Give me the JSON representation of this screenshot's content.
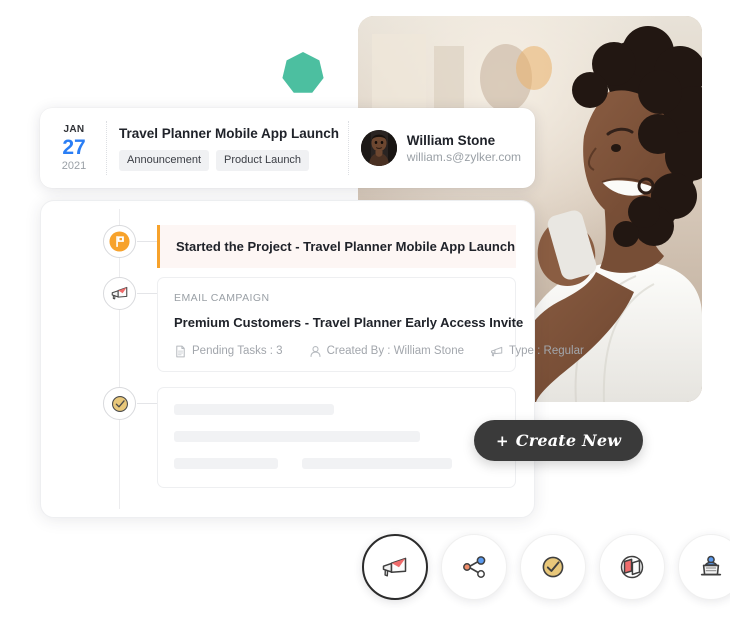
{
  "decor": {
    "heptagon_color": "#4cbfa0"
  },
  "photo": {
    "alt": "woman-on-phone-photo",
    "bg_color": "#c8b6a4"
  },
  "meta_card": {
    "date": {
      "month": "JAN",
      "day": "27",
      "year": "2021",
      "day_color": "#2a7ef5"
    },
    "title": "Travel Planner Mobile App Launch",
    "chips": [
      {
        "label": "Announcement"
      },
      {
        "label": "Product Launch"
      }
    ],
    "user": {
      "name": "William Stone",
      "email": "william.s@zylker.com",
      "avatar_icon": "user-photo-avatar"
    }
  },
  "timeline": {
    "items": [
      {
        "icon": "flag-icon",
        "icon_color": "#f7a22b",
        "type": "banner",
        "text": "Started the Project - Travel Planner Mobile App Launch",
        "accent_color": "#f7a22b",
        "bg_color": "#fdf6f4"
      },
      {
        "icon": "megaphone-envelope-icon",
        "type": "campaign",
        "kicker": "EMAIL CAMPAIGN",
        "title": "Premium Customers - Travel Planner Early Access Invite",
        "meta": [
          {
            "icon": "document-icon",
            "label": "Pending Tasks : 3"
          },
          {
            "icon": "person-icon",
            "label": "Created By : William Stone"
          },
          {
            "icon": "megaphone-icon",
            "label": "Type : Regular"
          }
        ]
      },
      {
        "icon": "check-circle-icon",
        "icon_color": "#e8c77a",
        "type": "skeleton",
        "placeholder_rows": 3
      }
    ]
  },
  "create_button": {
    "plus": "+",
    "label": "Create New"
  },
  "icon_bar": {
    "items": [
      {
        "name": "campaign-icon",
        "label": "Campaigns",
        "active": true
      },
      {
        "name": "share-network-icon",
        "label": "Social",
        "active": false
      },
      {
        "name": "check-circle-icon",
        "label": "Tasks",
        "active": false
      },
      {
        "name": "cube-icon",
        "label": "Products",
        "active": false
      },
      {
        "name": "podium-icon",
        "label": "Events",
        "active": false
      }
    ]
  }
}
